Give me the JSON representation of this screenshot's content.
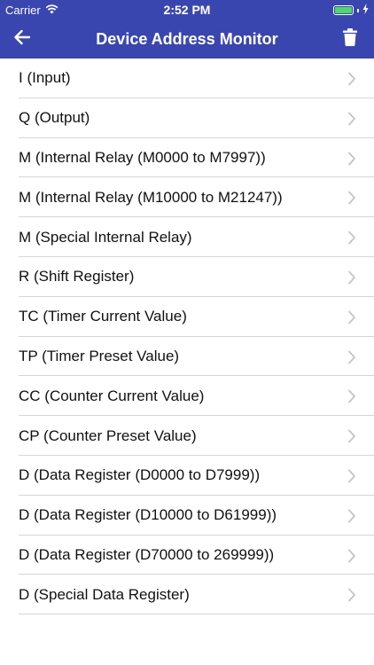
{
  "status_bar": {
    "carrier": "Carrier",
    "time": "2:52 PM",
    "battery_level": 1.0,
    "battery_color": "#4cd964"
  },
  "nav": {
    "title": "Device Address Monitor",
    "back_icon": "arrow-left-icon",
    "trash_icon": "trash-icon",
    "background": "#3a46b0"
  },
  "list": {
    "items": [
      {
        "label": "I (Input)"
      },
      {
        "label": "Q (Output)"
      },
      {
        "label": "M (Internal Relay (M0000 to M7997))"
      },
      {
        "label": "M (Internal Relay (M10000 to M21247))"
      },
      {
        "label": "M (Special Internal Relay)"
      },
      {
        "label": "R (Shift Register)"
      },
      {
        "label": "TC (Timer Current Value)"
      },
      {
        "label": "TP (Timer Preset Value)"
      },
      {
        "label": "CC (Counter Current Value)"
      },
      {
        "label": "CP (Counter Preset Value)"
      },
      {
        "label": "D (Data Register (D0000 to D7999))"
      },
      {
        "label": "D (Data Register (D10000 to D61999))"
      },
      {
        "label": "D (Data Register (D70000 to 269999))"
      },
      {
        "label": "D (Special Data Register)"
      }
    ]
  }
}
